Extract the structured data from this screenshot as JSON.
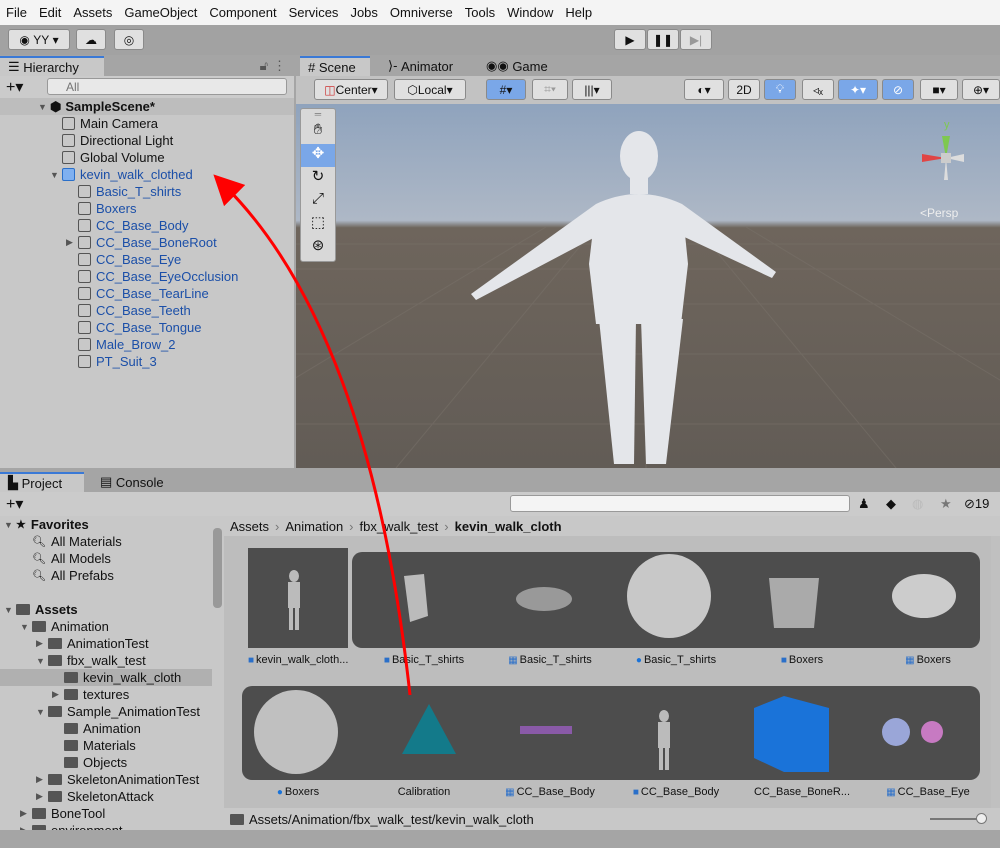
{
  "menu": [
    "File",
    "Edit",
    "Assets",
    "GameObject",
    "Component",
    "Services",
    "Jobs",
    "Omniverse",
    "Tools",
    "Window",
    "Help"
  ],
  "toolbar": {
    "account": "YY",
    "play_icon": "play-icon",
    "pause_icon": "pause-icon",
    "step_icon": "step-icon"
  },
  "hierarchy": {
    "tab": "Hierarchy",
    "search_placeholder": "All",
    "scene": "SampleScene*",
    "items": [
      {
        "label": "Main Camera",
        "depth": 1,
        "prefab": false,
        "expand": ""
      },
      {
        "label": "Directional Light",
        "depth": 1,
        "prefab": false,
        "expand": ""
      },
      {
        "label": "Global Volume",
        "depth": 1,
        "prefab": false,
        "expand": ""
      },
      {
        "label": "kevin_walk_clothed",
        "depth": 1,
        "prefab": true,
        "expand": "▼"
      },
      {
        "label": "Basic_T_shirts",
        "depth": 2,
        "prefab": true,
        "expand": ""
      },
      {
        "label": "Boxers",
        "depth": 2,
        "prefab": true,
        "expand": ""
      },
      {
        "label": "CC_Base_Body",
        "depth": 2,
        "prefab": true,
        "expand": ""
      },
      {
        "label": "CC_Base_BoneRoot",
        "depth": 2,
        "prefab": true,
        "expand": "▶"
      },
      {
        "label": "CC_Base_Eye",
        "depth": 2,
        "prefab": true,
        "expand": ""
      },
      {
        "label": "CC_Base_EyeOcclusion",
        "depth": 2,
        "prefab": true,
        "expand": ""
      },
      {
        "label": "CC_Base_TearLine",
        "depth": 2,
        "prefab": true,
        "expand": ""
      },
      {
        "label": "CC_Base_Teeth",
        "depth": 2,
        "prefab": true,
        "expand": ""
      },
      {
        "label": "CC_Base_Tongue",
        "depth": 2,
        "prefab": true,
        "expand": ""
      },
      {
        "label": "Male_Brow_2",
        "depth": 2,
        "prefab": true,
        "expand": ""
      },
      {
        "label": "PT_Suit_3",
        "depth": 2,
        "prefab": true,
        "expand": ""
      }
    ]
  },
  "scene": {
    "tabs": [
      "Scene",
      "Animator",
      "Game"
    ],
    "pivot": "Center",
    "space": "Local",
    "mode_2d": "2D",
    "persp": "<Persp",
    "gizmo_y": "y"
  },
  "project": {
    "tabs": [
      "Project",
      "Console"
    ],
    "hidden_count": "19",
    "breadcrumb": [
      "Assets",
      "Animation",
      "fbx_walk_test",
      "kevin_walk_cloth"
    ],
    "tree": [
      {
        "label": "Favorites",
        "depth": 0,
        "kind": "star",
        "bold": true
      },
      {
        "label": "All Materials",
        "depth": 1,
        "kind": "search"
      },
      {
        "label": "All Models",
        "depth": 1,
        "kind": "search"
      },
      {
        "label": "All Prefabs",
        "depth": 1,
        "kind": "search"
      },
      {
        "label": "",
        "depth": 0,
        "kind": "gap"
      },
      {
        "label": "Assets",
        "depth": 0,
        "kind": "folder",
        "bold": true,
        "expand": "▼"
      },
      {
        "label": "Animation",
        "depth": 1,
        "kind": "folder",
        "expand": "▼"
      },
      {
        "label": "AnimationTest",
        "depth": 2,
        "kind": "folder",
        "expand": "▶"
      },
      {
        "label": "fbx_walk_test",
        "depth": 2,
        "kind": "folder",
        "expand": "▼"
      },
      {
        "label": "kevin_walk_cloth",
        "depth": 3,
        "kind": "folder",
        "selected": true
      },
      {
        "label": "textures",
        "depth": 3,
        "kind": "folder",
        "expand": "▶"
      },
      {
        "label": "Sample_AnimationTest",
        "depth": 2,
        "kind": "folder",
        "expand": "▼"
      },
      {
        "label": "Animation",
        "depth": 3,
        "kind": "folder"
      },
      {
        "label": "Materials",
        "depth": 3,
        "kind": "folder"
      },
      {
        "label": "Objects",
        "depth": 3,
        "kind": "folder"
      },
      {
        "label": "SkeletonAnimationTest",
        "depth": 2,
        "kind": "folder",
        "expand": "▶"
      },
      {
        "label": "SkeletonAttack",
        "depth": 2,
        "kind": "folder",
        "expand": "▶"
      },
      {
        "label": "BoneTool",
        "depth": 1,
        "kind": "folder",
        "expand": "▶"
      },
      {
        "label": "environment",
        "depth": 1,
        "kind": "folder",
        "expand": "▶"
      }
    ],
    "row1": [
      {
        "label": "kevin_walk_cloth...",
        "icon": "prefab"
      },
      {
        "label": "Basic_T_shirts",
        "icon": "prefab"
      },
      {
        "label": "Basic_T_shirts",
        "icon": "mesh"
      },
      {
        "label": "Basic_T_shirts",
        "icon": "material"
      },
      {
        "label": "Boxers",
        "icon": "prefab"
      },
      {
        "label": "Boxers",
        "icon": "mesh"
      }
    ],
    "row2": [
      {
        "label": "Boxers",
        "icon": "material"
      },
      {
        "label": "Calibration",
        "icon": ""
      },
      {
        "label": "CC_Base_Body",
        "icon": "mesh"
      },
      {
        "label": "CC_Base_Body",
        "icon": "prefab"
      },
      {
        "label": "CC_Base_BoneR...",
        "icon": ""
      },
      {
        "label": "CC_Base_Eye",
        "icon": "mesh"
      }
    ],
    "path": "Assets/Animation/fbx_walk_test/kevin_walk_cloth"
  },
  "colors": {
    "accent": "#3a79d6",
    "selection": "#7aa7e8",
    "arrow": "#ff0000",
    "calibration": "#137a8a"
  }
}
